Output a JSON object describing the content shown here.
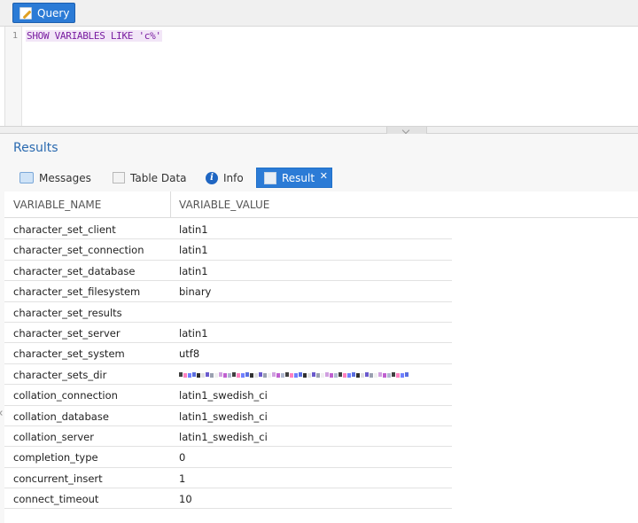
{
  "toolbar": {
    "query_label": "Query"
  },
  "editor": {
    "line_number": "1",
    "code": "SHOW VARIABLES LIKE 'c%'"
  },
  "results": {
    "title": "Results",
    "tabs": [
      {
        "label": "Messages",
        "icon": "messages-icon"
      },
      {
        "label": "Table Data",
        "icon": "table-icon"
      },
      {
        "label": "Info",
        "icon": "info-icon"
      },
      {
        "label": "Result",
        "icon": "result-icon",
        "active": true,
        "close": "✕"
      }
    ]
  },
  "grid": {
    "columns": [
      "VARIABLE_NAME",
      "VARIABLE_VALUE"
    ],
    "rows": [
      {
        "name": "character_set_client",
        "value": "latin1"
      },
      {
        "name": "character_set_connection",
        "value": "latin1"
      },
      {
        "name": "character_set_database",
        "value": "latin1"
      },
      {
        "name": "character_set_filesystem",
        "value": "binary"
      },
      {
        "name": "character_set_results",
        "value": ""
      },
      {
        "name": "character_set_server",
        "value": "latin1"
      },
      {
        "name": "character_set_system",
        "value": "utf8"
      },
      {
        "name": "character_sets_dir",
        "value": "",
        "pixelated": true
      },
      {
        "name": "collation_connection",
        "value": "latin1_swedish_ci"
      },
      {
        "name": "collation_database",
        "value": "latin1_swedish_ci"
      },
      {
        "name": "collation_server",
        "value": "latin1_swedish_ci"
      },
      {
        "name": "completion_type",
        "value": "0"
      },
      {
        "name": "concurrent_insert",
        "value": "1"
      },
      {
        "name": "connect_timeout",
        "value": "10"
      }
    ]
  },
  "colors": {
    "accent": "#2b7bd6",
    "title": "#2a6ab0",
    "code": "#7a1ea1"
  }
}
